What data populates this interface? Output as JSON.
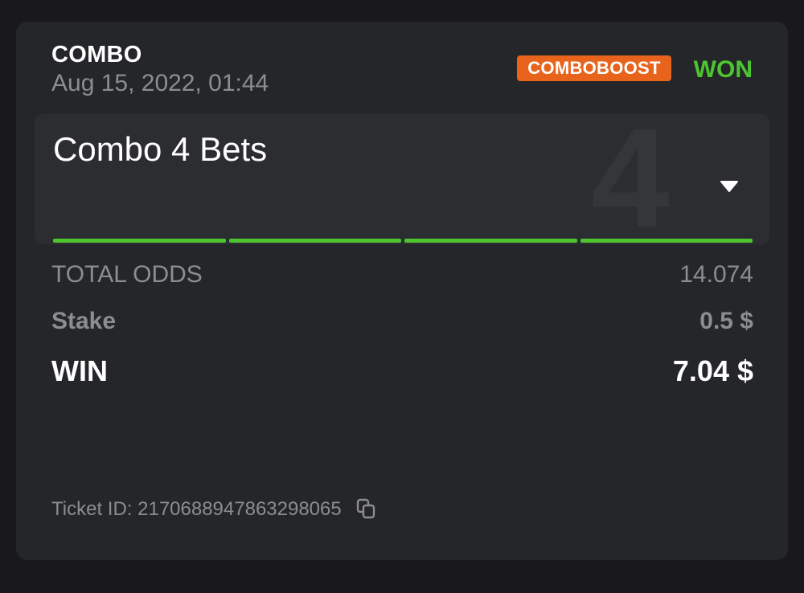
{
  "bet": {
    "type": "COMBO",
    "date": "Aug 15, 2022, 01:44",
    "badge": "COMBOBOOST",
    "status": "WON"
  },
  "combo": {
    "title": "Combo 4 Bets",
    "count": "4",
    "legs_won": 4,
    "legs_total": 4
  },
  "summary": {
    "total_odds_label": "TOTAL ODDS",
    "total_odds_value": "14.074",
    "stake_label": "Stake",
    "stake_value": "0.5 $",
    "win_label": "WIN",
    "win_value": "7.04 $"
  },
  "ticket": {
    "text": "Ticket ID: 2170688947863298065"
  },
  "icons": {
    "dropdown": "caret-down-icon",
    "copy": "copy-icon"
  },
  "colors": {
    "background": "#19191c",
    "card": "#252629",
    "accent_green": "#4cc62f",
    "badge_orange": "#e8641c",
    "muted_text": "#8c8d91"
  }
}
